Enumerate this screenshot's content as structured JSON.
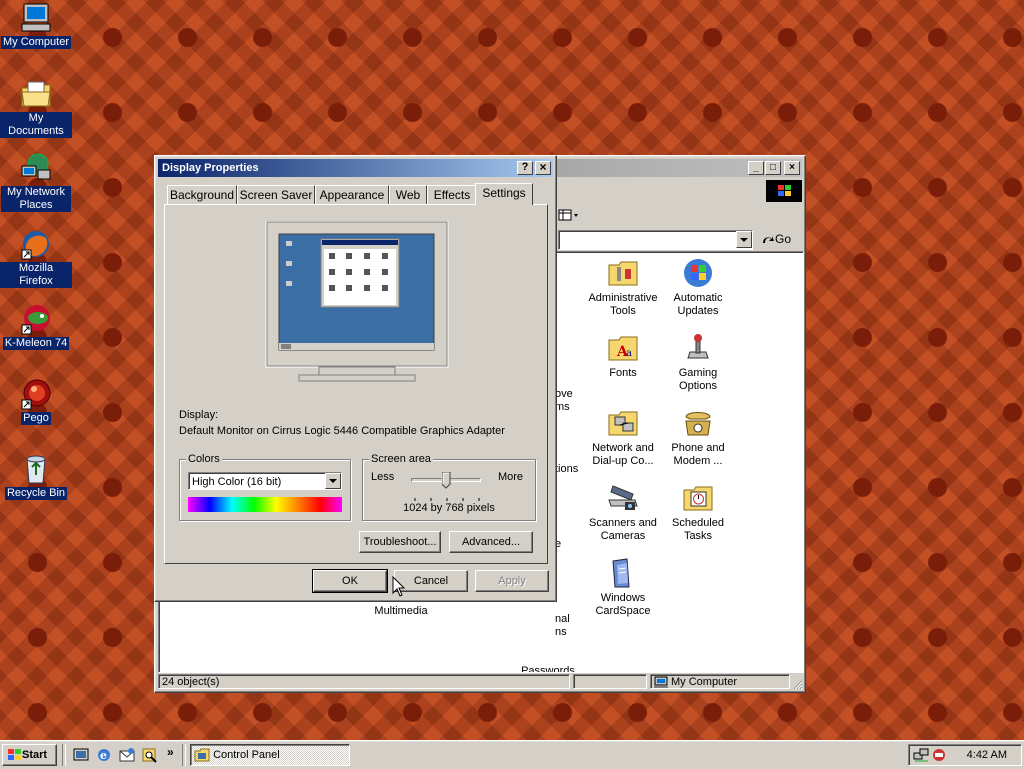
{
  "desktop": {
    "icons": [
      {
        "label": "My Computer",
        "icon": "computer-icon"
      },
      {
        "label": "My Documents",
        "icon": "folder-documents-icon"
      },
      {
        "label": "My Network Places",
        "icon": "network-icon"
      },
      {
        "label": "Mozilla Firefox",
        "icon": "firefox-icon"
      },
      {
        "label": "K-Meleon 74",
        "icon": "kmeleon-icon"
      },
      {
        "label": "Pego",
        "icon": "pego-icon"
      },
      {
        "label": "Recycle Bin",
        "icon": "recycle-bin-icon"
      }
    ]
  },
  "control_panel": {
    "go_label": "Go",
    "items": [
      {
        "label": "Administrative Tools",
        "icon": "admin-tools-icon"
      },
      {
        "label": "Automatic Updates",
        "icon": "windows-update-icon"
      },
      {
        "label": "Fonts",
        "icon": "fonts-icon"
      },
      {
        "label": "Gaming Options",
        "icon": "joystick-icon"
      },
      {
        "label": "Network and Dial-up Co...",
        "icon": "network-folder-icon"
      },
      {
        "label": "Phone and Modem ...",
        "icon": "phone-icon"
      },
      {
        "label": "Scanners and Cameras",
        "icon": "scanner-icon"
      },
      {
        "label": "Scheduled Tasks",
        "icon": "scheduled-tasks-icon"
      },
      {
        "label": "Windows CardSpace",
        "icon": "cardspace-icon"
      },
      {
        "label": "Multimedia",
        "icon": "multimedia-icon"
      },
      {
        "label": "Passwords",
        "icon": "passwords-icon"
      }
    ],
    "partial_labels": {
      "remove": "ove",
      "remove2": "ms",
      "options": "tions",
      "e": "e",
      "nal": "nal",
      "ns": "ns",
      "nd": "nd"
    },
    "status_count": "24 object(s)",
    "status_location": "My Computer"
  },
  "display_properties": {
    "title": "Display Properties",
    "help_button": "?",
    "close_button": "×",
    "tabs": [
      {
        "label": "Background"
      },
      {
        "label": "Screen Saver"
      },
      {
        "label": "Appearance"
      },
      {
        "label": "Web"
      },
      {
        "label": "Effects"
      },
      {
        "label": "Settings"
      }
    ],
    "active_tab": "Settings",
    "display_label": "Display:",
    "display_value": "Default Monitor on Cirrus Logic 5446 Compatible Graphics Adapter",
    "colors_group": "Colors",
    "colors_selected": "High Color (16 bit)",
    "screen_area_group": "Screen area",
    "less_label": "Less",
    "more_label": "More",
    "resolution": "1024 by 768 pixels",
    "slider_position": 0.5,
    "troubleshoot_button": "Troubleshoot...",
    "advanced_button": "Advanced...",
    "ok_button": "OK",
    "cancel_button": "Cancel",
    "apply_button": "Apply"
  },
  "taskbar": {
    "start_label": "Start",
    "task_label": "Control Panel",
    "clock": "4:42 AM",
    "chevron": "»"
  },
  "colors": {
    "title_active_start": "#0a246a",
    "title_active_end": "#a6caf0",
    "title_inactive_start": "#808080",
    "title_inactive_end": "#c0c0c0",
    "face": "#d4d0c8",
    "monitor_screen": "#3a6ea5"
  }
}
